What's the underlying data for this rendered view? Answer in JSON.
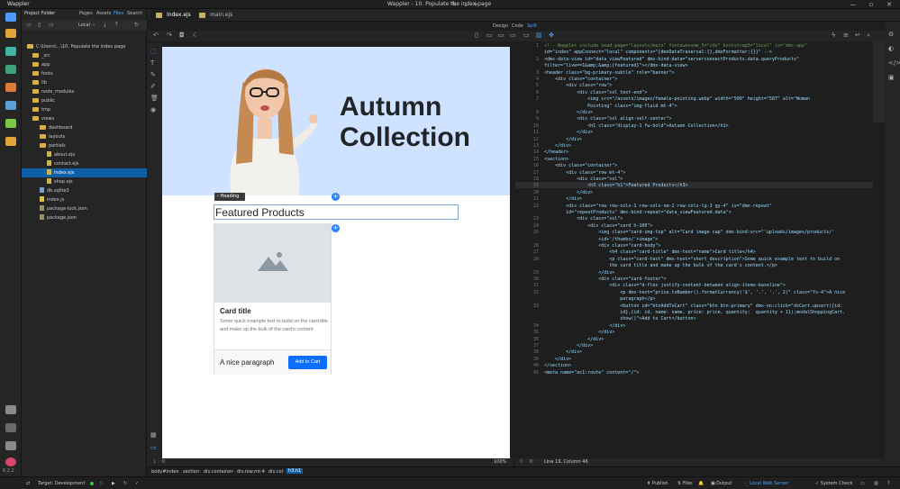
{
  "app": {
    "name": "Wappler",
    "window_title": "Wappler - 10. Populate the index page",
    "version": "6.2.2"
  },
  "project_panel": {
    "title": "Project Folder",
    "tabs": [
      "Pages",
      "Assets",
      "Files",
      "Search"
    ],
    "active_tab": "Files",
    "target_select": "Local",
    "tree": [
      {
        "label": "C:\\Users\\...\\10. Populate the index page",
        "type": "root",
        "depth": 0
      },
      {
        "label": "_src",
        "type": "folder",
        "depth": 1
      },
      {
        "label": "app",
        "type": "folder",
        "depth": 1
      },
      {
        "label": "fonts",
        "type": "folder",
        "depth": 1
      },
      {
        "label": "lib",
        "type": "folder",
        "depth": 1
      },
      {
        "label": "node_modules",
        "type": "folder",
        "depth": 1
      },
      {
        "label": "public",
        "type": "folder",
        "depth": 1
      },
      {
        "label": "tmp",
        "type": "folder",
        "depth": 1
      },
      {
        "label": "views",
        "type": "folder",
        "depth": 1,
        "open": true
      },
      {
        "label": "dashboard",
        "type": "folder",
        "depth": 2
      },
      {
        "label": "layouts",
        "type": "folder",
        "depth": 2
      },
      {
        "label": "partials",
        "type": "folder",
        "depth": 2
      },
      {
        "label": "about.ejs",
        "type": "ejs",
        "depth": 2
      },
      {
        "label": "contact.ejs",
        "type": "ejs",
        "depth": 2
      },
      {
        "label": "index.ejs",
        "type": "ejs",
        "depth": 2,
        "selected": true
      },
      {
        "label": "shop.ejs",
        "type": "ejs",
        "depth": 2
      },
      {
        "label": "db.sqlite3",
        "type": "db",
        "depth": 1
      },
      {
        "label": "index.js",
        "type": "js",
        "depth": 1
      },
      {
        "label": "package-lock.json",
        "type": "json",
        "depth": 1
      },
      {
        "label": "package.json",
        "type": "json",
        "depth": 1
      }
    ]
  },
  "editor_tabs": [
    {
      "label": "index.ejs",
      "active": true
    },
    {
      "label": "main.ejs",
      "active": false
    }
  ],
  "view_modes": {
    "design": "Design",
    "code": "Code",
    "split": "Split",
    "active": "Split"
  },
  "design": {
    "hero_title_line1": "Autumn",
    "hero_title_line2": "Collection",
    "heading_tag": "Heading",
    "featured_heading": "Featured Products",
    "card": {
      "title": "Card title",
      "text": "Some quick example text to build on the card title and make up the bulk of the card's content.",
      "price_text": "A nice paragraph",
      "button": "Add to Cart"
    },
    "zoom": "100%",
    "warnings": "1",
    "errors": "0"
  },
  "code_status": {
    "warnings": "0",
    "errors": "0",
    "position": "Line 19, Column 46"
  },
  "code_lines": [
    {
      "n": "1",
      "t": "<!-- Wappler include head-page=\"layouts/main\" fontawesome_5=\"cdn\" bootstrap5=\"local\" is=\"dmx-app\""
    },
    {
      "n": "",
      "t": "id=\"index\" appConnect=\"local\" components=\"{dmxDataTraversal:{},dmxFormatter:{}}\" -->"
    },
    {
      "n": "2",
      "t": "<dmx-data-view id=\"data_viewFeatured\" dmx-bind:data=\"serverconnectProducts.data.queryProducts\""
    },
    {
      "n": "",
      "t": "filter=\"live==1&amp;&amp;{featured}\"></dmx-data-view>"
    },
    {
      "n": "3",
      "t": "<header class=\"bg-primary-subtle\" role=\"banner\">"
    },
    {
      "n": "4",
      "t": "    <div class=\"container\">"
    },
    {
      "n": "5",
      "t": "        <div class=\"row\">"
    },
    {
      "n": "6",
      "t": "            <div class=\"col text-end\">"
    },
    {
      "n": "7",
      "t": "                <img src=\"/assets/images/female-pointing.webp\" width=\"500\" height=\"587\" alt=\"Woman"
    },
    {
      "n": "",
      "t": "                Pointing\" class=\"img-fluid mt-4\">"
    },
    {
      "n": "8",
      "t": "            </div>"
    },
    {
      "n": "9",
      "t": "            <div class=\"col align-self-center\">"
    },
    {
      "n": "10",
      "t": "                <h1 class=\"display-1 fw-bold\">Autumn Collection</h1>"
    },
    {
      "n": "11",
      "t": "            </div>"
    },
    {
      "n": "12",
      "t": "        </div>"
    },
    {
      "n": "13",
      "t": "    </div>"
    },
    {
      "n": "14",
      "t": "</header>"
    },
    {
      "n": "15",
      "t": "<section>"
    },
    {
      "n": "16",
      "t": "    <div class=\"container\">"
    },
    {
      "n": "17",
      "t": "        <div class=\"row mt-4\">"
    },
    {
      "n": "18",
      "t": "            <div class=\"col\">"
    },
    {
      "n": "19",
      "t": "                <h3 class=\"h1\">Featured Products</h3>"
    },
    {
      "n": "20",
      "t": "            </div>"
    },
    {
      "n": "21",
      "t": "        </div>"
    },
    {
      "n": "22",
      "t": "        <div class=\"row row-cols-1 row-cols-sm-2 row-cols-lg-3 gy-4\" is=\"dmx-repeat\""
    },
    {
      "n": "",
      "t": "        id=\"repeatProducts\" dmx-bind:repeat=\"data_viewFeatured.data\">"
    },
    {
      "n": "23",
      "t": "            <div class=\"col\">"
    },
    {
      "n": "24",
      "t": "                <div class=\"card h-100\">"
    },
    {
      "n": "25",
      "t": "                    <img class=\"card-img-top\" alt=\"Card image cap\" dmx-bind:src=\"'uploads/images/products/'"
    },
    {
      "n": "",
      "t": "                    +id+'/thumbs/'+image\">"
    },
    {
      "n": "26",
      "t": "                    <div class=\"card-body\">"
    },
    {
      "n": "27",
      "t": "                        <h4 class=\"card-title\" dmx-text=\"name\">Card title</h4>"
    },
    {
      "n": "28",
      "t": "                        <p class=\"card-text\" dmx-text=\"short_description\">Some quick example text to build on"
    },
    {
      "n": "",
      "t": "                        the card title and make up the bulk of the card's content.</p>"
    },
    {
      "n": "29",
      "t": "                    </div>"
    },
    {
      "n": "30",
      "t": "                    <div class=\"card-footer\">"
    },
    {
      "n": "31",
      "t": "                        <div class=\"d-flex justify-content-between align-items-baseline\">"
    },
    {
      "n": "32",
      "t": "                            <p dmx-text=\"price.toNumber().formatCurrency('$', '.', ',', 2)\" class=\"fs-4\">A nice"
    },
    {
      "n": "",
      "t": "                            paragraph</p>"
    },
    {
      "n": "33",
      "t": "                            <button id=\"btnAddToCart\" class=\"btn btn-primary\" dmx-on:click=\"dsCart.upsert({id:"
    },
    {
      "n": "",
      "t": "                            id},{id: id, name: name, price: price, quantity:  quantity + 1});modalShoppingCart."
    },
    {
      "n": "",
      "t": "                            show()\">Add to Cart</button>"
    },
    {
      "n": "34",
      "t": "                        </div>"
    },
    {
      "n": "35",
      "t": "                    </div>"
    },
    {
      "n": "36",
      "t": "                </div>"
    },
    {
      "n": "37",
      "t": "            </div>"
    },
    {
      "n": "38",
      "t": "        </div>"
    },
    {
      "n": "39",
      "t": "    </div>"
    },
    {
      "n": "40",
      "t": "</section>"
    },
    {
      "n": "41",
      "t": "<meta name=\"ac1:route\" content=\"/\">"
    }
  ],
  "breadcrumb": [
    "body#index",
    "section",
    "div.container",
    "div.row.mt-4",
    "div.col",
    "h3.h1"
  ],
  "statusbar": {
    "target_label": "Target: Development",
    "publish": "Publish",
    "files": "Files",
    "output": "Output",
    "server": "Local Web Server",
    "system_check": "System Check"
  },
  "colors": {
    "accent": "#0e5fa8",
    "hero_bg": "#cfe2ff",
    "primary_button": "#0d6efd",
    "selection_outline": "#7aa7e0"
  }
}
